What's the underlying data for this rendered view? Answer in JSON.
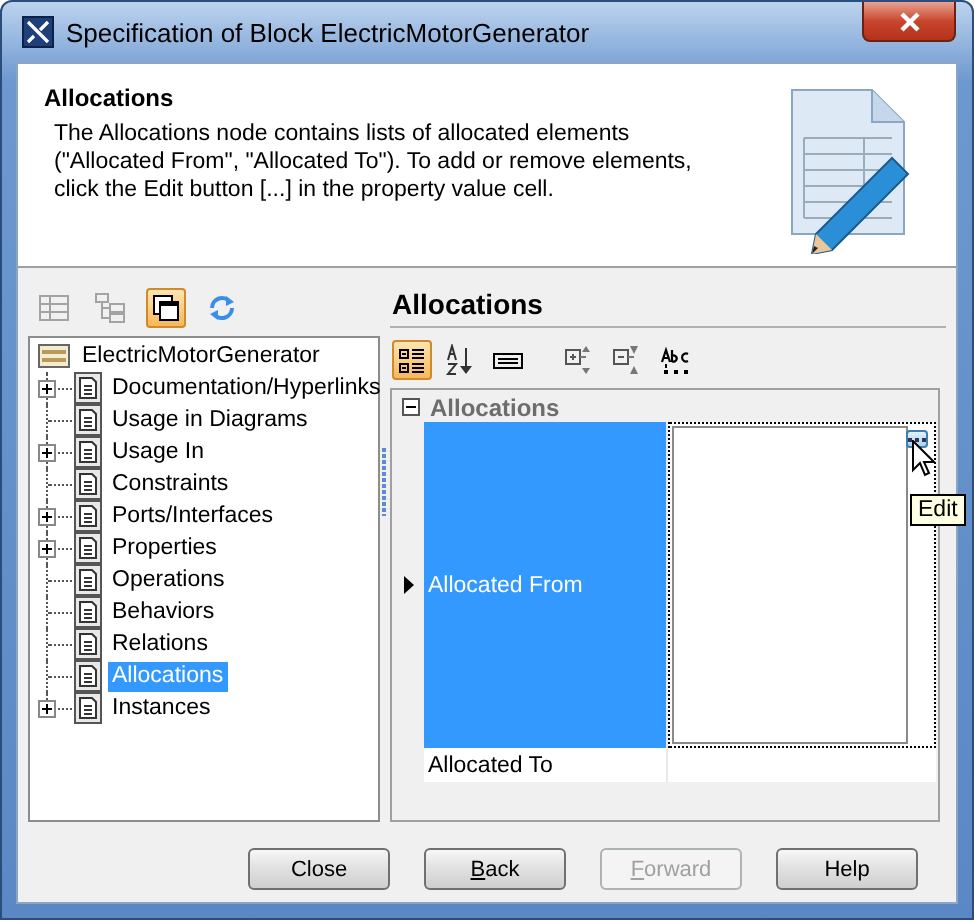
{
  "window": {
    "title": "Specification of Block ElectricMotorGenerator"
  },
  "header": {
    "title": "Allocations",
    "description": "The Allocations node contains lists of allocated elements (\"Allocated From\", \"Allocated To\"). To add or remove elements, click the Edit button [...] in the property value cell."
  },
  "tree_toolbar": [
    {
      "kind": "table",
      "disabled": true,
      "selected": false
    },
    {
      "kind": "hierarchy",
      "disabled": true,
      "selected": false
    },
    {
      "kind": "windows",
      "disabled": false,
      "selected": true
    },
    {
      "kind": "refresh",
      "disabled": false,
      "selected": false
    }
  ],
  "tree": {
    "label": "ElectricMotorGenerator",
    "children": [
      {
        "label": "Documentation/Hyperlinks",
        "expandable": true,
        "selected": false
      },
      {
        "label": "Usage in Diagrams",
        "expandable": false,
        "selected": false
      },
      {
        "label": "Usage In",
        "expandable": true,
        "selected": false
      },
      {
        "label": "Constraints",
        "expandable": false,
        "selected": false
      },
      {
        "label": "Ports/Interfaces",
        "expandable": true,
        "selected": false
      },
      {
        "label": "Properties",
        "expandable": true,
        "selected": false
      },
      {
        "label": "Operations",
        "expandable": false,
        "selected": false
      },
      {
        "label": "Behaviors",
        "expandable": false,
        "selected": false
      },
      {
        "label": "Relations",
        "expandable": false,
        "selected": false
      },
      {
        "label": "Allocations",
        "expandable": false,
        "selected": true
      },
      {
        "label": "Instances",
        "expandable": true,
        "selected": false
      }
    ]
  },
  "panel": {
    "title": "Allocations",
    "toolbar": [
      {
        "kind": "categorized",
        "selected": true
      },
      {
        "kind": "sort",
        "selected": false
      },
      {
        "kind": "field",
        "selected": false
      },
      {
        "kind": "expand",
        "selected": false
      },
      {
        "kind": "collapse",
        "selected": false
      },
      {
        "kind": "spelling",
        "selected": false
      }
    ],
    "group": {
      "label": "Allocations",
      "expanded": true
    },
    "rows": [
      {
        "name": "Allocated From",
        "selected": true,
        "editing": true
      },
      {
        "name": "Allocated To",
        "selected": false,
        "editing": false
      }
    ],
    "tooltip": "Edit"
  },
  "buttons": [
    {
      "label": "Close",
      "disabled": false,
      "underline_first": false
    },
    {
      "label": "Back",
      "disabled": false,
      "underline_first": true
    },
    {
      "label": "Forward",
      "disabled": true,
      "underline_first": true
    },
    {
      "label": "Help",
      "disabled": false,
      "underline_first": false
    }
  ]
}
